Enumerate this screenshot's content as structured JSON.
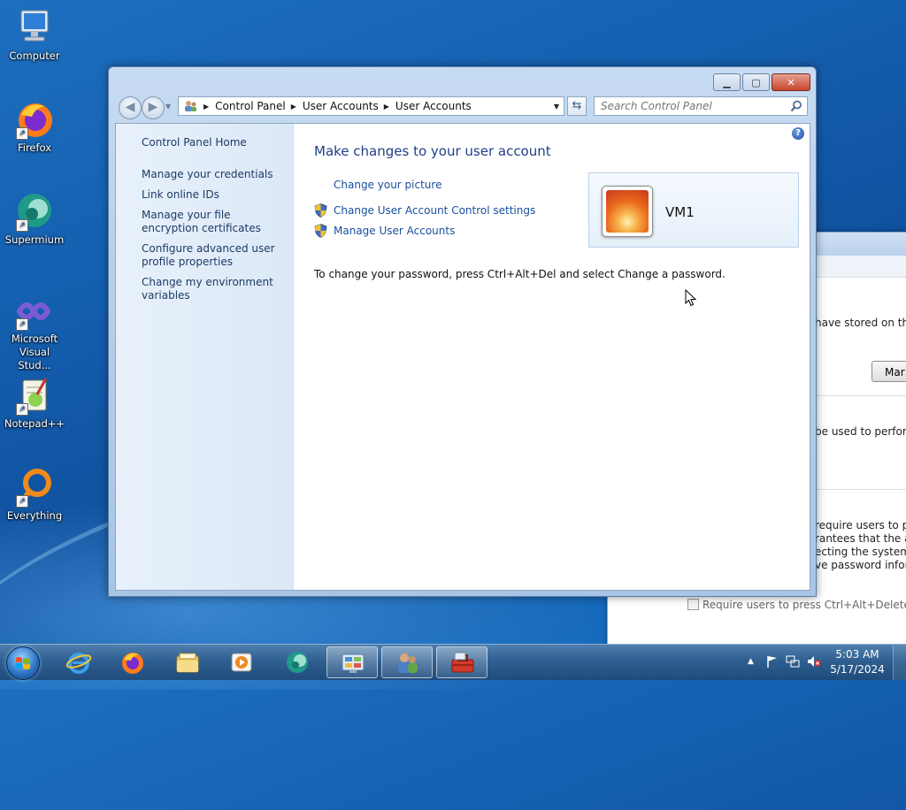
{
  "desktop": {
    "icons": [
      {
        "label": "Computer"
      },
      {
        "label": "Firefox"
      },
      {
        "label": "Supermium"
      },
      {
        "label": "Microsoft Visual Stud..."
      },
      {
        "label": "Notepad++"
      },
      {
        "label": "Everything"
      }
    ]
  },
  "window": {
    "breadcrumb": [
      "Control Panel",
      "User Accounts",
      "User Accounts"
    ],
    "search_placeholder": "Search Control Panel",
    "left_pane": {
      "home_link": "Control Panel Home",
      "links": [
        "Manage your credentials",
        "Link online IDs",
        "Manage your file encryption certificates",
        "Configure advanced user profile properties",
        "Change my environment variables"
      ]
    },
    "heading": "Make changes to your user account",
    "tasks": [
      {
        "label": "Change your picture",
        "icon": "none"
      },
      {
        "label": "Change User Account Control settings",
        "icon": "uac-shield-icon"
      },
      {
        "label": "Manage User Accounts",
        "icon": "uac-shield-icon"
      }
    ],
    "password_note": "To change your password, press Ctrl+Alt+Del and select Change a password.",
    "account": {
      "name": "VM1",
      "picture": "orange-flower"
    },
    "help_label": "?"
  },
  "background_window": {
    "lines": [
      "have stored on this",
      "be used to perform",
      "require users to pre",
      "rantees that the aut",
      "ecting the system fr",
      "ve password inform"
    ],
    "button_label": "Mar",
    "checkbox_label": "Require users to press Ctrl+Alt+Delete"
  },
  "taskbar": {
    "pinned": [
      "internet-explorer-icon",
      "firefox-icon",
      "windows-explorer-icon",
      "media-player-icon",
      "supermium-icon",
      "control-panel-icon",
      "user-accounts-icon",
      "toolbox-icon"
    ],
    "clock": {
      "time": "5:03 AM",
      "date": "5/17/2024"
    }
  },
  "colors": {
    "link": "#1a4f9c",
    "heading": "#1e3f8a",
    "taskbar": "#2f5f90",
    "desktop": "#1560b0"
  }
}
